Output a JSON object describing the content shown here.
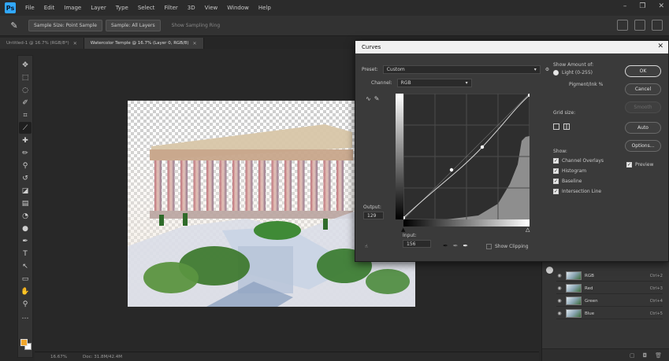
{
  "menubar": {
    "logo": "Ps",
    "items": [
      "File",
      "Edit",
      "Image",
      "Layer",
      "Type",
      "Select",
      "Filter",
      "3D",
      "View",
      "Window",
      "Help"
    ]
  },
  "optionsbar": {
    "sample_size": "Sample Size: Point Sample",
    "sample": "Sample: All Layers",
    "ring": "Show Sampling Ring"
  },
  "tabs": [
    {
      "label": "Untitled-1 @ 16.7% (RGB/8*)"
    },
    {
      "label": "Watercolor Temple @ 16.7% (Layer 0, RGB/8)"
    }
  ],
  "statusbar": {
    "zoom": "16.67%",
    "doc": "Doc: 31.8M/42.4M"
  },
  "channels": [
    {
      "name": "RGB",
      "shortcut": "Ctrl+2"
    },
    {
      "name": "Red",
      "shortcut": "Ctrl+3"
    },
    {
      "name": "Green",
      "shortcut": "Ctrl+4"
    },
    {
      "name": "Blue",
      "shortcut": "Ctrl+5"
    }
  ],
  "curves": {
    "title": "Curves",
    "preset_label": "Preset:",
    "preset_value": "Custom",
    "channel_label": "Channel:",
    "channel_value": "RGB",
    "output_label": "Output:",
    "output_value": "129",
    "input_label": "Input:",
    "input_value": "156",
    "show_clipping": "Show Clipping",
    "show_amount": "Show Amount of:",
    "light": "Light (0-255)",
    "pigment": "Pigment/Ink %",
    "grid_size": "Grid size:",
    "show": "Show:",
    "options": [
      "Channel Overlays",
      "Histogram",
      "Baseline",
      "Intersection Line"
    ],
    "ok": "OK",
    "cancel": "Cancel",
    "smooth": "Smooth",
    "auto": "Auto",
    "options_btn": "Options...",
    "preview": "Preview"
  }
}
